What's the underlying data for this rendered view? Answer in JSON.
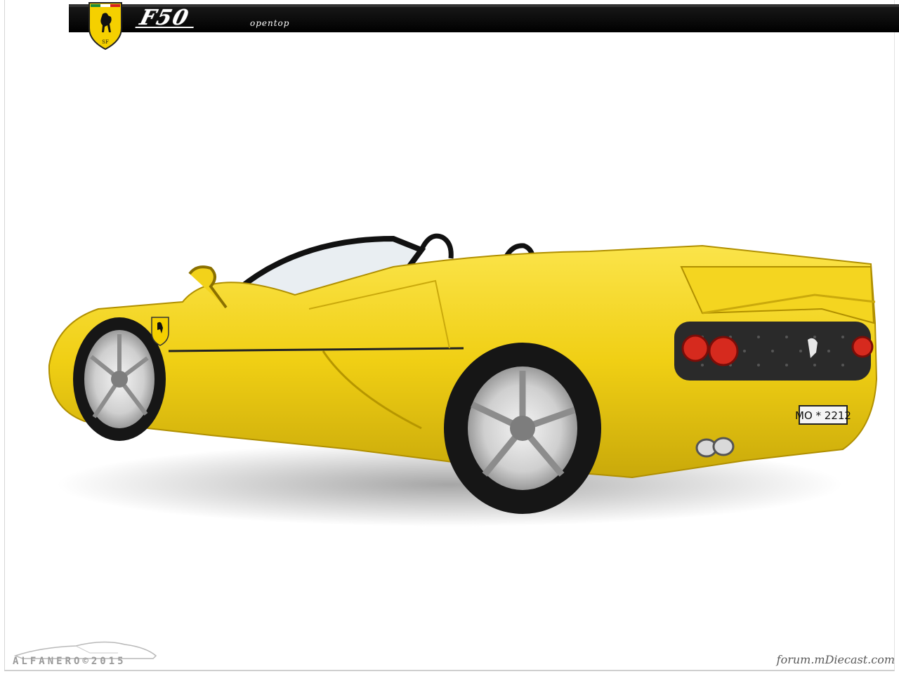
{
  "header": {
    "model_name": "F50",
    "model_variant": "opentop",
    "logo": "ferrari-shield-icon",
    "bar_color": "#000000",
    "shield_color": "#f5d000"
  },
  "photo": {
    "car_color": "#f3d21a",
    "license_plate": "MO * 2212"
  },
  "watermarks": {
    "left_text": "ALFANERO©2015",
    "right_text": "forum.mDiecast.com"
  }
}
